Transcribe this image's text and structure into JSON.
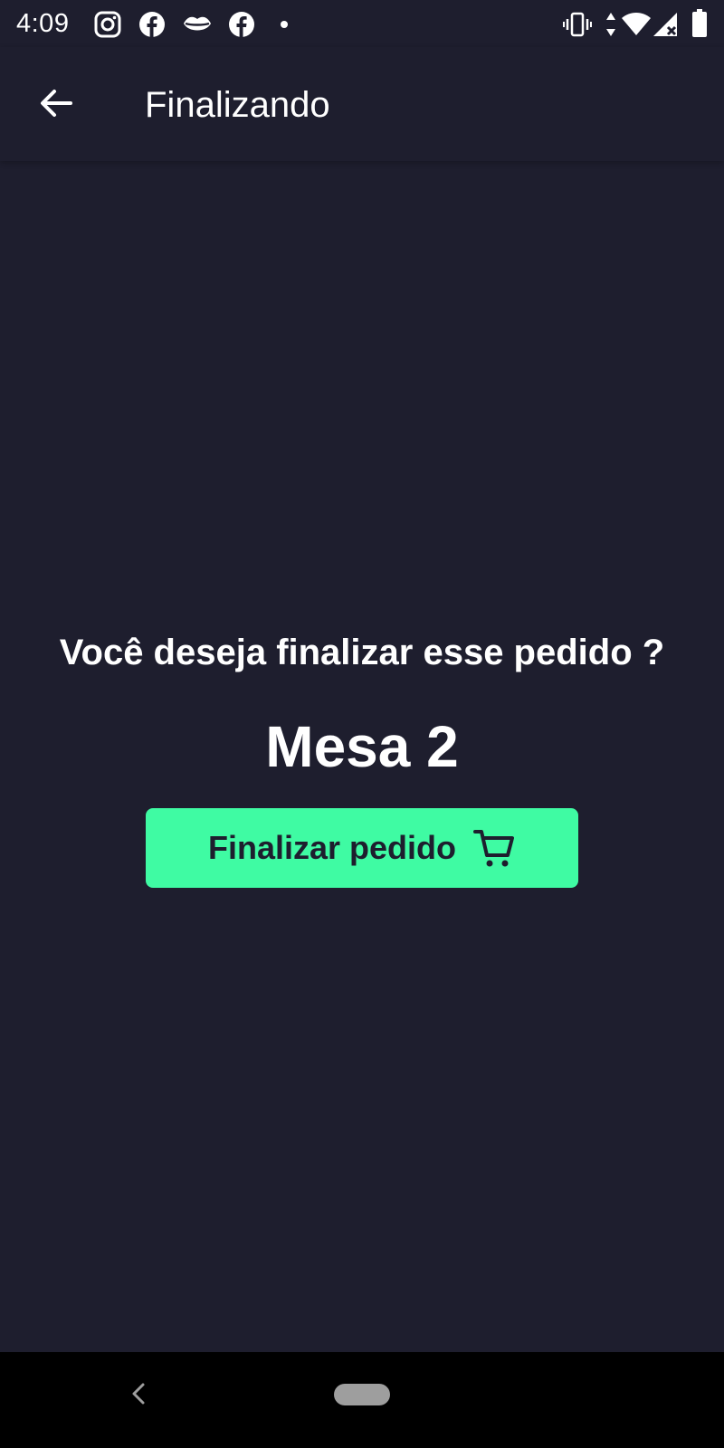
{
  "status_bar": {
    "time": "4:09",
    "left_icons": [
      "instagram-icon",
      "facebook-icon",
      "lips-icon",
      "facebook-icon",
      "dot-icon"
    ],
    "right_icons": [
      "vibrate-icon",
      "data-arrows-icon",
      "wifi-icon",
      "signal-icon",
      "battery-icon"
    ]
  },
  "app_bar": {
    "title": "Finalizando",
    "back_icon": "arrow-left-icon"
  },
  "main": {
    "question": "Você deseja finalizar esse pedido ?",
    "table_name": "Mesa 2",
    "finish_button_label": "Finalizar pedido",
    "finish_button_icon": "cart-icon"
  },
  "nav_bar": {
    "back_icon": "chevron-left-icon",
    "home_icon": "home-pill-icon"
  },
  "colors": {
    "background": "#1e1e2e",
    "accent": "#3ffba3",
    "text": "#ffffff",
    "nav_bar": "#000000"
  }
}
